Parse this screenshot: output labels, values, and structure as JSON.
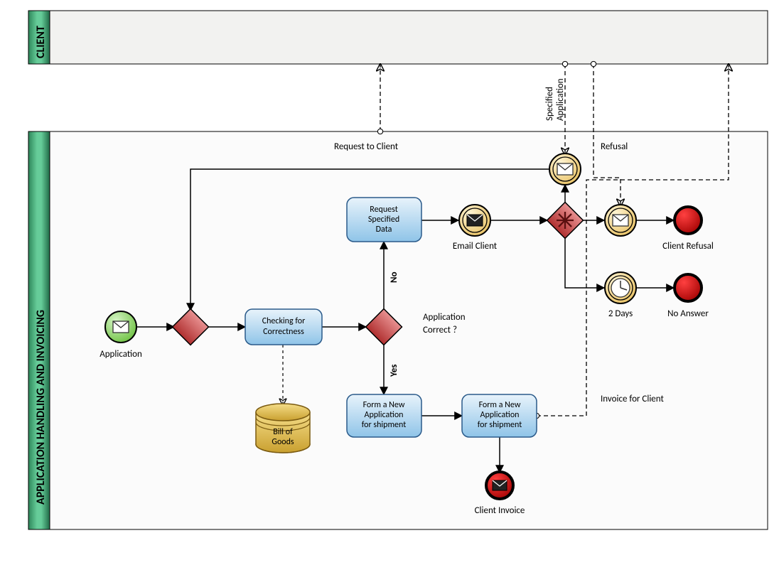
{
  "pools": {
    "client": "CLIENT",
    "app": "APPLICATION HANDLING AND INVOICING"
  },
  "events": {
    "application": "Application",
    "email_client": "Email Client",
    "client_refusal": "Client Refusal",
    "no_answer": "No Answer",
    "two_days": "2 Days",
    "client_invoice": "Client Invoice"
  },
  "tasks": {
    "checking": "Checking for Correctness",
    "request_data": "Request Specified Data",
    "form_app1": "Form a New Application for shipment",
    "form_app2": "Form a New Application for shipment"
  },
  "data": {
    "bill_of_goods": "Bill of Goods"
  },
  "labels": {
    "request_to_client": "Request to Client",
    "specified_application": "Specified Application",
    "refusal": "Refusal",
    "application_correct": "Application Correct ?",
    "invoice_for_client": "Invoice for Client",
    "no": "No",
    "yes": "Yes"
  }
}
